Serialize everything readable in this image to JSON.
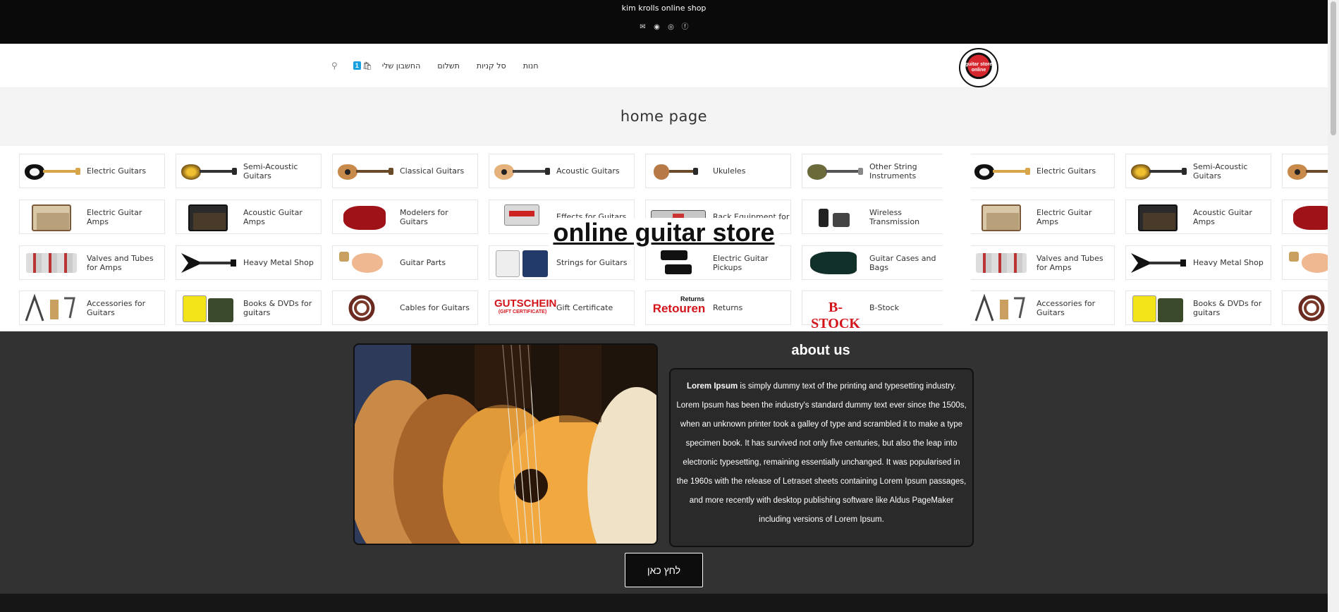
{
  "topbar": {
    "title": "kim krolls online shop",
    "social_icons": [
      "mail-icon",
      "discord-icon",
      "instagram-icon",
      "facebook-icon"
    ]
  },
  "header": {
    "logo_text": "guitar store online",
    "nav": [
      "חנות",
      "סל קניות",
      "תשלום",
      "החשבון שלי"
    ],
    "cart_count": "1"
  },
  "page_title": "home page",
  "store_title": "online guitar store",
  "categories": [
    [
      "Electric Guitars",
      "Semi-Acoustic Guitars",
      "Classical Guitars",
      "Acoustic Guitars",
      "Ukuleles",
      "Other String Instruments"
    ],
    [
      "Electric Guitar Amps",
      "Acoustic Guitar Amps",
      "Modelers for Guitars",
      "Effects for Guitars",
      "Rack Equipment for",
      "Wireless Transmission"
    ],
    [
      "Valves and Tubes for Amps",
      "Heavy Metal Shop",
      "Guitar Parts",
      "Strings for Guitars",
      "Electric Guitar Pickups",
      "Guitar Cases and Bags"
    ],
    [
      "Accessories for Guitars",
      "Books & DVDs for guitars",
      "Cables for Guitars",
      "Gift Certificate",
      "Returns",
      "B-Stock"
    ]
  ],
  "category_thumbs": [
    [
      "sunburst-electric",
      "gold-semi",
      "classical",
      "acoustic",
      "ukulele",
      "mandolin"
    ],
    [
      "tan-amp",
      "dark-amp",
      "red-modeler",
      "effects-box",
      "rack-unit",
      "wireless-unit"
    ],
    [
      "tubes",
      "v-guitar",
      "guitar-parts",
      "strings",
      "pickups",
      "case"
    ],
    [
      "accessories",
      "books",
      "cable",
      "gutschein",
      "returns",
      "bstock"
    ]
  ],
  "thumb_text": {
    "gutschein": "GUTSCHEIN",
    "gutschein_sub": "(GIFT CERTIFICATE)",
    "returns_top": "Returns",
    "returns_main": "Retouren",
    "bstock": "B-STOCK"
  },
  "about": {
    "heading": "about us",
    "body_bold": "Lorem Ipsum",
    "body_rest": " is simply dummy text of the printing and typesetting industry. Lorem Ipsum has been the industry's standard dummy text ever since the 1500s, when an unknown printer took a galley of type and scrambled it to make a type specimen book. It has survived not only five centuries, but also the leap into electronic typesetting, remaining essentially unchanged. It was popularised in the 1960s with the release of Letraset sheets containing Lorem Ipsum passages, and more recently with desktop publishing software like Aldus PageMaker including versions of Lorem Ipsum.",
    "button_label": "לחץ כאן"
  }
}
